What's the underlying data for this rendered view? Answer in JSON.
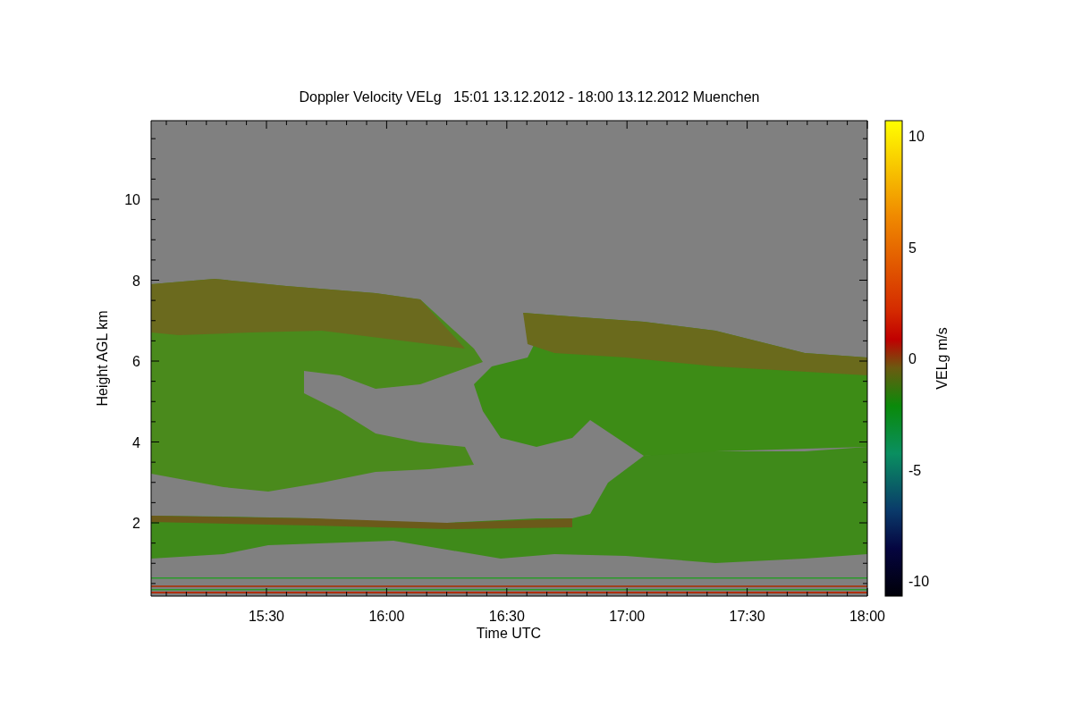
{
  "plot": {
    "title": "Doppler Velocity VELg   15:01 13.12.2012 - 18:00 13.12.2012 Muenchen",
    "xlabel": "Time UTC",
    "ylabel": "Height AGL km",
    "xtick_labels": [
      "15:30",
      "16:00",
      "16:30",
      "17:00",
      "17:30",
      "18:00"
    ],
    "ytick_labels": [
      "10",
      "8",
      "6",
      "4",
      "2"
    ]
  },
  "colorbar": {
    "label": "VELg m/s",
    "tick_labels": [
      "10",
      "5",
      "0",
      "-5",
      "-10"
    ]
  }
}
